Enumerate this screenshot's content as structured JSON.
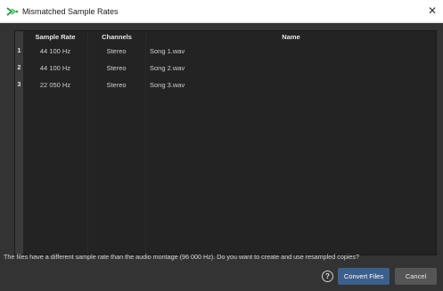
{
  "window": {
    "title": "Mismatched Sample Rates",
    "close_glyph": "✕",
    "app_icon": "wavelab-icon"
  },
  "table": {
    "columns": [
      "Sample Rate",
      "Channels",
      "Name"
    ],
    "rows": [
      {
        "index": "1",
        "sample_rate": "44 100 Hz",
        "channels": "Stereo",
        "name": "Song 1.wav"
      },
      {
        "index": "2",
        "sample_rate": "44 100 Hz",
        "channels": "Stereo",
        "name": "Song 2.wav"
      },
      {
        "index": "3",
        "sample_rate": "22 050 Hz",
        "channels": "Stereo",
        "name": "Song 3.wav"
      }
    ]
  },
  "message": "The  files have a different sample rate than the audio montage (96 000 Hz). Do you want to create and use resampled copies?",
  "footer": {
    "help_glyph": "?",
    "convert_label": "Convert Files",
    "cancel_label": "Cancel"
  },
  "colors": {
    "accent": "#3d5f8c",
    "background": "#333333",
    "table_background": "#232323"
  }
}
